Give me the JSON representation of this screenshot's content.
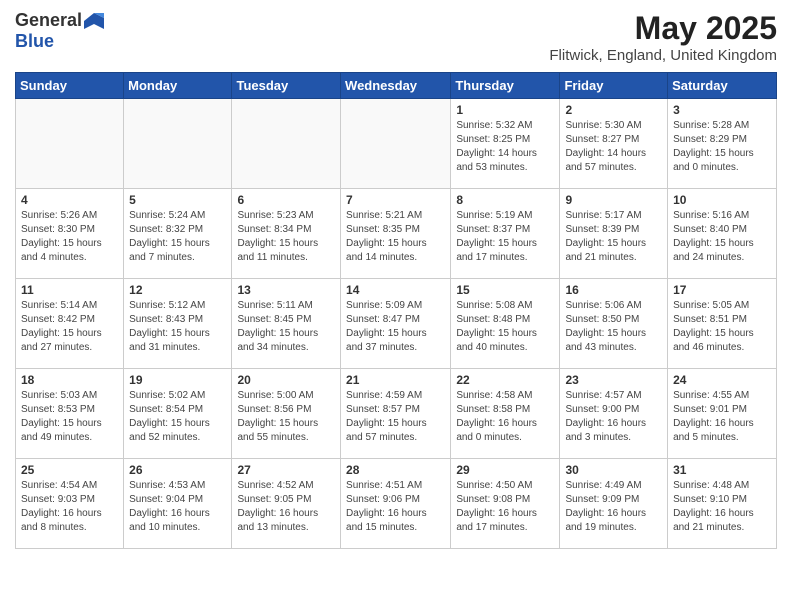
{
  "header": {
    "logo_general": "General",
    "logo_blue": "Blue",
    "main_title": "May 2025",
    "subtitle": "Flitwick, England, United Kingdom"
  },
  "days_of_week": [
    "Sunday",
    "Monday",
    "Tuesday",
    "Wednesday",
    "Thursday",
    "Friday",
    "Saturday"
  ],
  "weeks": [
    [
      {
        "day": "",
        "info": ""
      },
      {
        "day": "",
        "info": ""
      },
      {
        "day": "",
        "info": ""
      },
      {
        "day": "",
        "info": ""
      },
      {
        "day": "1",
        "info": "Sunrise: 5:32 AM\nSunset: 8:25 PM\nDaylight: 14 hours\nand 53 minutes."
      },
      {
        "day": "2",
        "info": "Sunrise: 5:30 AM\nSunset: 8:27 PM\nDaylight: 14 hours\nand 57 minutes."
      },
      {
        "day": "3",
        "info": "Sunrise: 5:28 AM\nSunset: 8:29 PM\nDaylight: 15 hours\nand 0 minutes."
      }
    ],
    [
      {
        "day": "4",
        "info": "Sunrise: 5:26 AM\nSunset: 8:30 PM\nDaylight: 15 hours\nand 4 minutes."
      },
      {
        "day": "5",
        "info": "Sunrise: 5:24 AM\nSunset: 8:32 PM\nDaylight: 15 hours\nand 7 minutes."
      },
      {
        "day": "6",
        "info": "Sunrise: 5:23 AM\nSunset: 8:34 PM\nDaylight: 15 hours\nand 11 minutes."
      },
      {
        "day": "7",
        "info": "Sunrise: 5:21 AM\nSunset: 8:35 PM\nDaylight: 15 hours\nand 14 minutes."
      },
      {
        "day": "8",
        "info": "Sunrise: 5:19 AM\nSunset: 8:37 PM\nDaylight: 15 hours\nand 17 minutes."
      },
      {
        "day": "9",
        "info": "Sunrise: 5:17 AM\nSunset: 8:39 PM\nDaylight: 15 hours\nand 21 minutes."
      },
      {
        "day": "10",
        "info": "Sunrise: 5:16 AM\nSunset: 8:40 PM\nDaylight: 15 hours\nand 24 minutes."
      }
    ],
    [
      {
        "day": "11",
        "info": "Sunrise: 5:14 AM\nSunset: 8:42 PM\nDaylight: 15 hours\nand 27 minutes."
      },
      {
        "day": "12",
        "info": "Sunrise: 5:12 AM\nSunset: 8:43 PM\nDaylight: 15 hours\nand 31 minutes."
      },
      {
        "day": "13",
        "info": "Sunrise: 5:11 AM\nSunset: 8:45 PM\nDaylight: 15 hours\nand 34 minutes."
      },
      {
        "day": "14",
        "info": "Sunrise: 5:09 AM\nSunset: 8:47 PM\nDaylight: 15 hours\nand 37 minutes."
      },
      {
        "day": "15",
        "info": "Sunrise: 5:08 AM\nSunset: 8:48 PM\nDaylight: 15 hours\nand 40 minutes."
      },
      {
        "day": "16",
        "info": "Sunrise: 5:06 AM\nSunset: 8:50 PM\nDaylight: 15 hours\nand 43 minutes."
      },
      {
        "day": "17",
        "info": "Sunrise: 5:05 AM\nSunset: 8:51 PM\nDaylight: 15 hours\nand 46 minutes."
      }
    ],
    [
      {
        "day": "18",
        "info": "Sunrise: 5:03 AM\nSunset: 8:53 PM\nDaylight: 15 hours\nand 49 minutes."
      },
      {
        "day": "19",
        "info": "Sunrise: 5:02 AM\nSunset: 8:54 PM\nDaylight: 15 hours\nand 52 minutes."
      },
      {
        "day": "20",
        "info": "Sunrise: 5:00 AM\nSunset: 8:56 PM\nDaylight: 15 hours\nand 55 minutes."
      },
      {
        "day": "21",
        "info": "Sunrise: 4:59 AM\nSunset: 8:57 PM\nDaylight: 15 hours\nand 57 minutes."
      },
      {
        "day": "22",
        "info": "Sunrise: 4:58 AM\nSunset: 8:58 PM\nDaylight: 16 hours\nand 0 minutes."
      },
      {
        "day": "23",
        "info": "Sunrise: 4:57 AM\nSunset: 9:00 PM\nDaylight: 16 hours\nand 3 minutes."
      },
      {
        "day": "24",
        "info": "Sunrise: 4:55 AM\nSunset: 9:01 PM\nDaylight: 16 hours\nand 5 minutes."
      }
    ],
    [
      {
        "day": "25",
        "info": "Sunrise: 4:54 AM\nSunset: 9:03 PM\nDaylight: 16 hours\nand 8 minutes."
      },
      {
        "day": "26",
        "info": "Sunrise: 4:53 AM\nSunset: 9:04 PM\nDaylight: 16 hours\nand 10 minutes."
      },
      {
        "day": "27",
        "info": "Sunrise: 4:52 AM\nSunset: 9:05 PM\nDaylight: 16 hours\nand 13 minutes."
      },
      {
        "day": "28",
        "info": "Sunrise: 4:51 AM\nSunset: 9:06 PM\nDaylight: 16 hours\nand 15 minutes."
      },
      {
        "day": "29",
        "info": "Sunrise: 4:50 AM\nSunset: 9:08 PM\nDaylight: 16 hours\nand 17 minutes."
      },
      {
        "day": "30",
        "info": "Sunrise: 4:49 AM\nSunset: 9:09 PM\nDaylight: 16 hours\nand 19 minutes."
      },
      {
        "day": "31",
        "info": "Sunrise: 4:48 AM\nSunset: 9:10 PM\nDaylight: 16 hours\nand 21 minutes."
      }
    ]
  ]
}
